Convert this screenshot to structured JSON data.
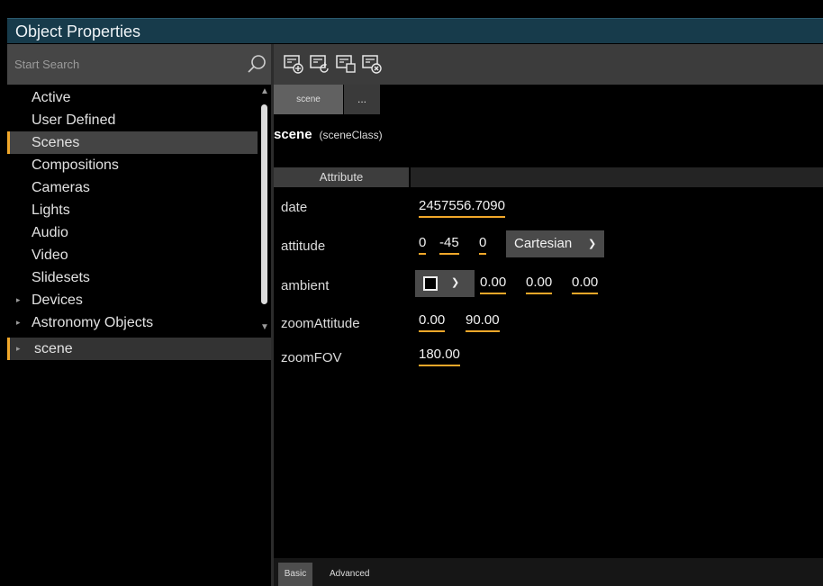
{
  "window": {
    "title": "Object Properties"
  },
  "search": {
    "placeholder": "Start Search"
  },
  "tree": {
    "items": [
      {
        "label": "Active",
        "caret": false
      },
      {
        "label": "User Defined",
        "caret": false
      },
      {
        "label": "Scenes",
        "caret": false,
        "selected": true
      },
      {
        "label": "Compositions",
        "caret": false
      },
      {
        "label": "Cameras",
        "caret": false
      },
      {
        "label": "Lights",
        "caret": false
      },
      {
        "label": "Audio",
        "caret": false
      },
      {
        "label": "Video",
        "caret": false
      },
      {
        "label": "Slidesets",
        "caret": false
      },
      {
        "label": "Devices",
        "caret": true
      },
      {
        "label": "Astronomy Objects",
        "caret": true
      },
      {
        "label": "scene",
        "caret": true,
        "highlighted": true
      }
    ],
    "caret_glyph": "▸"
  },
  "toolbar": {
    "icons": [
      "add-object-icon",
      "reset-object-icon",
      "copy-object-icon",
      "delete-object-icon"
    ]
  },
  "tabs": {
    "scene": "scene",
    "more": "..."
  },
  "object": {
    "name": "scene",
    "class": "(sceneClass)"
  },
  "attributes": {
    "header": "Attribute",
    "date": {
      "name": "date",
      "value": "2457556.7090"
    },
    "attitude": {
      "name": "attitude",
      "v1": "0",
      "v2": "-45",
      "v3": "0",
      "mode": "Cartesian"
    },
    "ambient": {
      "name": "ambient",
      "v1": "0.00",
      "v2": "0.00",
      "v3": "0.00",
      "swatch_color": "#000000"
    },
    "zoomAttitude": {
      "name": "zoomAttitude",
      "v1": "0.00",
      "v2": "90.00"
    },
    "zoomFOV": {
      "name": "zoomFOV",
      "value": "180.00"
    }
  },
  "bottom_tabs": {
    "basic": "Basic",
    "advanced": "Advanced"
  },
  "colors": {
    "accent": "#f0a72a",
    "title_bar": "#173b4b"
  }
}
